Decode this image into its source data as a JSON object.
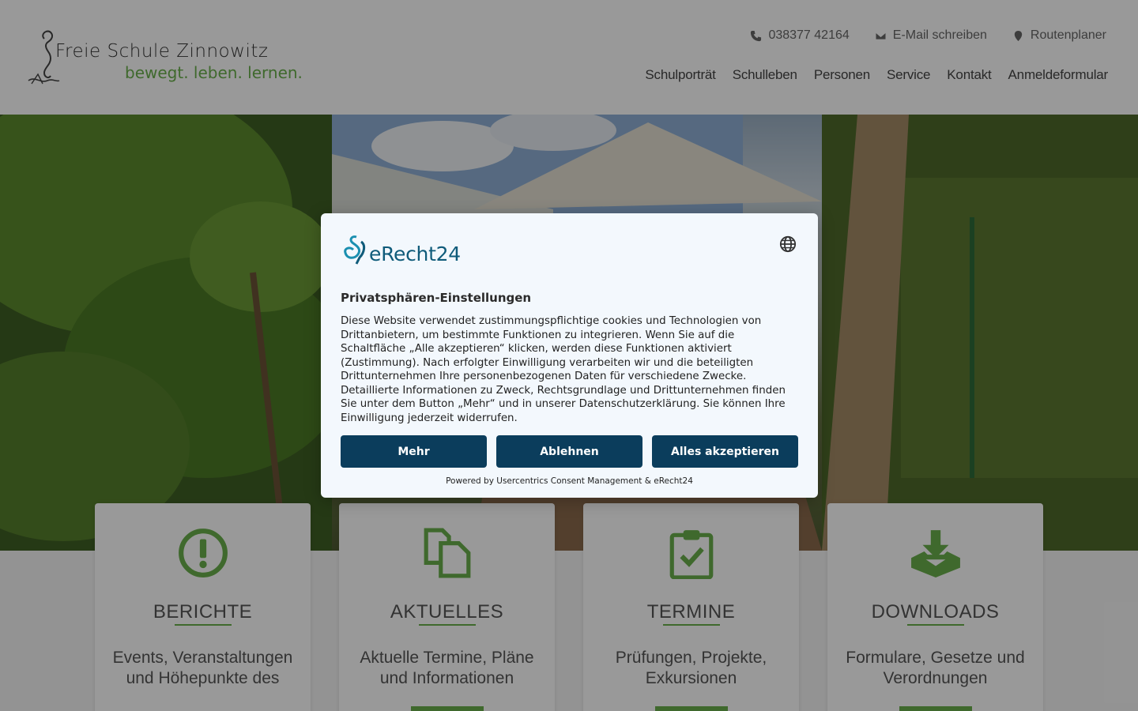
{
  "header": {
    "logo_name": "Freie Schule Zinnowitz",
    "logo_slogan": "bewegt. leben. lernen.",
    "contact": [
      {
        "icon": "phone-icon",
        "label": "038377 42164"
      },
      {
        "icon": "envelope-icon",
        "label": "E-Mail schreiben"
      },
      {
        "icon": "map-pin-icon",
        "label": "Routenplaner"
      }
    ],
    "nav": [
      "Schulporträt",
      "Schulleben",
      "Personen",
      "Service",
      "Kontakt",
      "Anmeldeformular"
    ]
  },
  "cards": [
    {
      "icon": "exclamation-circle-icon",
      "title": "BERICHTE",
      "desc": "Events, Veranstaltungen und Höhepunkte des"
    },
    {
      "icon": "copy-documents-icon",
      "title": "AKTUELLES",
      "desc": "Aktuelle Termine, Pläne und Informationen"
    },
    {
      "icon": "clipboard-check-icon",
      "title": "TERMINE",
      "desc": "Prüfungen, Projekte, Exkursionen"
    },
    {
      "icon": "download-tray-icon",
      "title": "DOWNLOADS",
      "desc": "Formulare, Gesetze und Verordnungen"
    }
  ],
  "consent": {
    "brand": "eRecht24",
    "title": "Privatsphären-Einstellungen",
    "body": "Diese Website verwendet zustimmungspflichtige cookies und Technologien von Drittanbietern, um bestimmte Funktionen zu integrieren. Wenn Sie auf die Schaltfläche „Alle akzeptieren“ klicken, werden diese Funktionen aktiviert (Zustimmung). Nach erfolgter Einwilligung verarbeiten wir und die beteiligten Drittunternehmen Ihre personenbezogenen Daten für verschiedene Zwecke. Detaillierte Informationen zu Zweck, Rechtsgrundlage und Drittunternehmen finden Sie unter dem Button „Mehr“ und in unserer Datenschutzerklärung. Sie können Ihre Einwilligung jederzeit widerrufen.",
    "buttons": {
      "more": "Mehr",
      "decline": "Ablehnen",
      "accept": "Alles akzeptieren"
    },
    "powered": "Powered by Usercentrics Consent Management & eRecht24"
  },
  "colors": {
    "brand_green": "#6ab04c",
    "button_navy": "#0b3d5c",
    "brand_teal": "#0f5b7a"
  }
}
